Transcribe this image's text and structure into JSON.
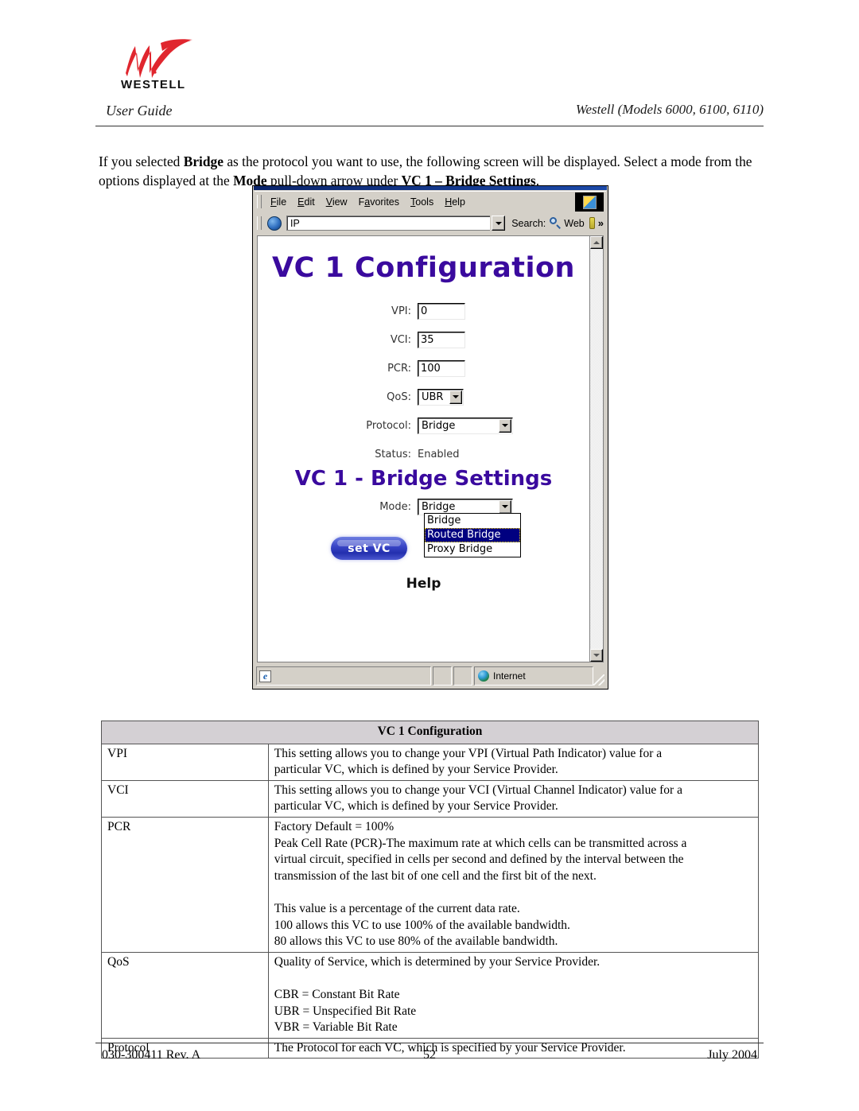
{
  "document": {
    "logo_word": "WESTELL",
    "logo_icon": "westell-w-logo",
    "header_left": "User Guide",
    "header_right": "Westell (Models 6000, 6100, 6110)",
    "intro": {
      "part1": "If you selected ",
      "bold1": "Bridge",
      "part2": " as the protocol you want to use, the following screen will be displayed. Select a mode from the options displayed at the ",
      "bold2": "Mode",
      "part3": " pull-down arrow under ",
      "bold3": "VC 1 – Bridge Settings",
      "part4": "."
    }
  },
  "browser": {
    "menus": [
      {
        "pre": "",
        "accel": "F",
        "post": "ile"
      },
      {
        "pre": "",
        "accel": "E",
        "post": "dit"
      },
      {
        "pre": "",
        "accel": "V",
        "post": "iew"
      },
      {
        "pre": "F",
        "accel": "a",
        "post": "vorites"
      },
      {
        "pre": "",
        "accel": "T",
        "post": "ools"
      },
      {
        "pre": "",
        "accel": "H",
        "post": "elp"
      }
    ],
    "address_value": "IP",
    "address_placeholder": "IP",
    "search_label": "Search:",
    "web_label": "Web",
    "more_chevron": "»",
    "status": {
      "zone": "Internet",
      "e_glyph": "e"
    }
  },
  "page_content": {
    "title": "VC 1 Configuration",
    "subtitle": "VC 1 - Bridge Settings",
    "fields": [
      {
        "label": "VPI:",
        "value": "0",
        "type": "text"
      },
      {
        "label": "VCI:",
        "value": "35",
        "type": "text"
      },
      {
        "label": "PCR:",
        "value": "100",
        "type": "text"
      },
      {
        "label": "QoS:",
        "value": "UBR",
        "type": "select"
      },
      {
        "label": "Protocol:",
        "value": "Bridge",
        "type": "select"
      },
      {
        "label": "Status:",
        "value": "Enabled",
        "type": "static"
      }
    ],
    "mode": {
      "label": "Mode:",
      "value": "Bridge",
      "options": [
        "Bridge",
        "Routed Bridge",
        "Proxy Bridge"
      ],
      "highlighted": "Routed Bridge"
    },
    "set_vc_button": "set VC",
    "help_link": "Help",
    "colors": {
      "heading": "#3a0a9e",
      "highlight_bg": "#000080",
      "button_blue": "#232fae"
    }
  },
  "table": {
    "header": "VC 1 Configuration",
    "rows": [
      {
        "term": "VPI",
        "lines": [
          "This setting allows you to change your VPI (Virtual Path Indicator) value for a",
          "particular VC, which is defined by your Service Provider."
        ]
      },
      {
        "term": "VCI",
        "lines": [
          "This setting allows you to change your VCI (Virtual Channel Indicator) value for a",
          "particular VC, which is defined by your Service Provider."
        ]
      },
      {
        "term": "PCR",
        "lines": [
          "Factory Default = 100%",
          "Peak Cell Rate (PCR)-The maximum rate at which cells can be transmitted across a",
          "virtual circuit, specified in cells per second and defined by the interval between the",
          "transmission of the last bit of one cell and the first bit of the next.",
          "",
          "This value is a percentage of the current data rate.",
          "100 allows this VC to use 100% of the available bandwidth.",
          "80 allows this VC to use 80% of the available bandwidth."
        ]
      },
      {
        "term": "QoS",
        "lines": [
          "Quality of Service, which is determined by your Service Provider.",
          "",
          "CBR = Constant Bit Rate",
          "UBR = Unspecified Bit Rate",
          "VBR = Variable Bit Rate"
        ]
      },
      {
        "term": "Protocol",
        "lines": [
          "The Protocol for each VC, which is specified by your Service Provider."
        ]
      }
    ]
  },
  "footer": {
    "left": "030-300411 Rev. A",
    "center": "52",
    "right": "July 2004"
  }
}
